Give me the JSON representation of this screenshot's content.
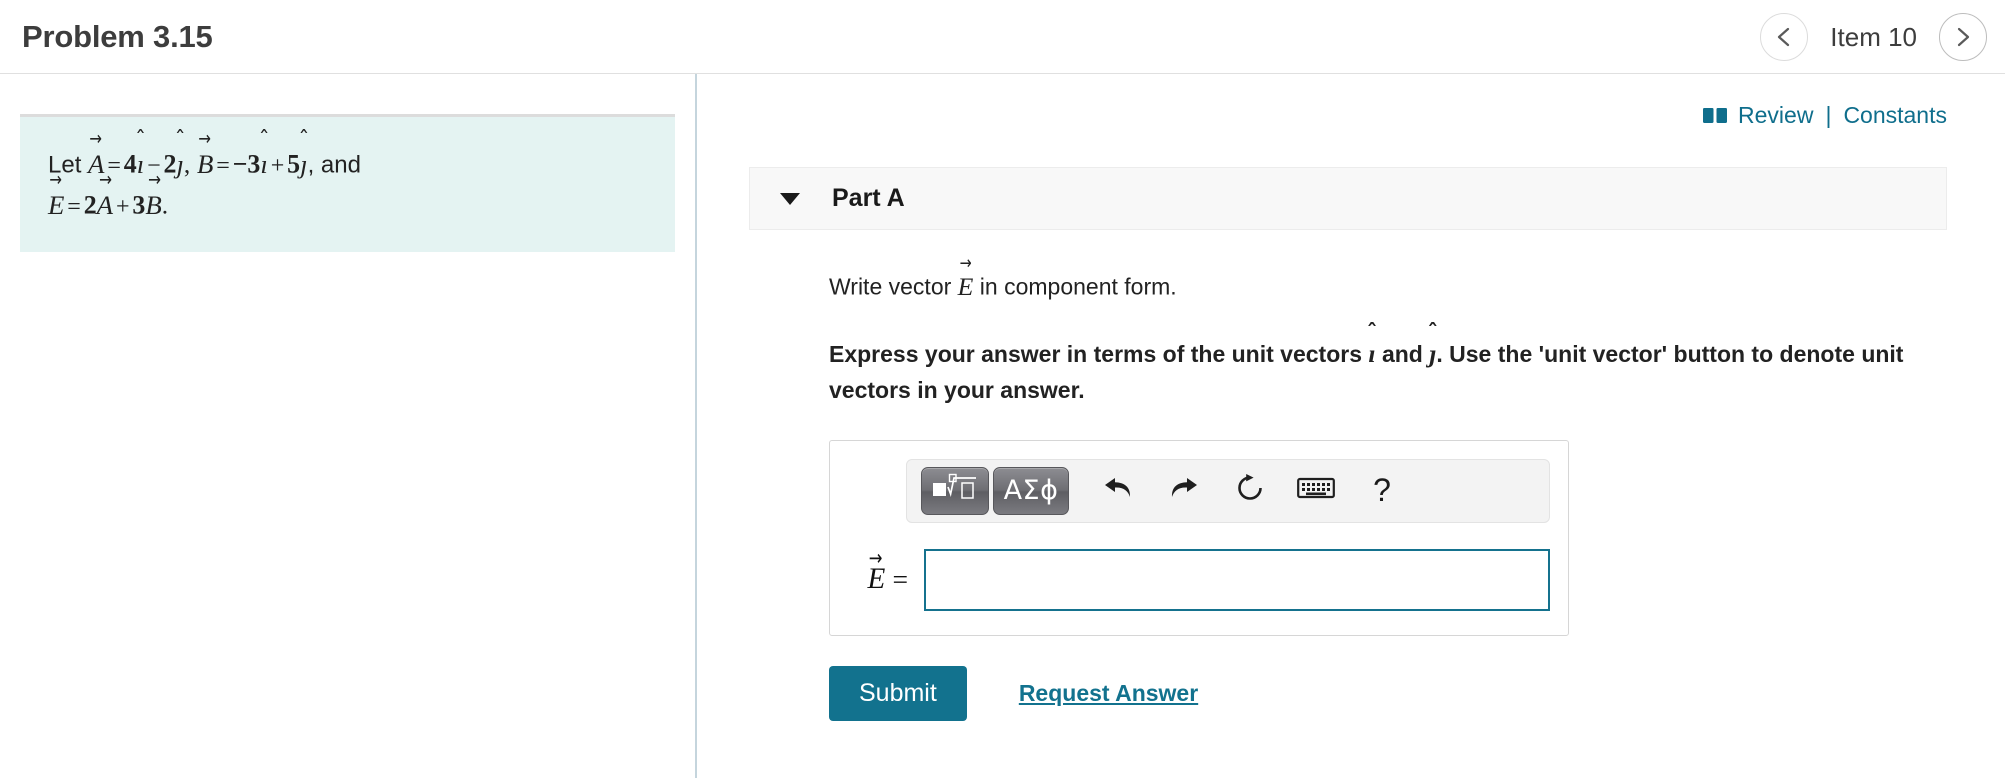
{
  "header": {
    "title": "Problem 3.15",
    "item_label": "Item 10",
    "prev_icon": "chevron-left-icon",
    "next_icon": "chevron-right-icon"
  },
  "problem": {
    "line1": {
      "lead": "Let",
      "vec_a": "A",
      "eq": "=",
      "a_i_coeff": "4",
      "i_hat": "ı",
      "minus": "−",
      "a_j_coeff": "2",
      "j_hat": "ȷ",
      "comma": ",",
      "vec_b": "B",
      "eq2": "=",
      "b_i_coeff": "−3",
      "plus": "+",
      "b_j_coeff": "5",
      "trailing": ", and"
    },
    "line2": {
      "vec_e": "E",
      "eq": "=",
      "coeff_a": "2",
      "vec_a": "A",
      "plus": "+",
      "coeff_b": "3",
      "vec_b": "B",
      "period": "."
    }
  },
  "review": {
    "book_icon": "book-icon",
    "review_label": "Review",
    "separator": "|",
    "constants_label": "Constants"
  },
  "part": {
    "caret_icon": "caret-down-icon",
    "title": "Part A",
    "question_prefix": "Write vector",
    "question_vector": "E",
    "question_suffix": "in component form.",
    "instruction_part1": "Express your answer in terms of the unit vectors",
    "instruction_i": "ı",
    "instruction_and": "and",
    "instruction_j": "ȷ",
    "instruction_part2": ". Use the 'unit vector' button to denote unit vectors in your answer."
  },
  "editor": {
    "toolbar": [
      {
        "name": "math-template-button",
        "type": "glyph",
        "icon": "sqrt-template-icon",
        "label": ""
      },
      {
        "name": "greek-symbols-button",
        "type": "text",
        "icon": "greek-letters-icon",
        "label": "ΑΣϕ"
      },
      {
        "name": "undo-button",
        "type": "icon",
        "icon": "undo-arrow-icon",
        "label": ""
      },
      {
        "name": "redo-button",
        "type": "icon",
        "icon": "redo-arrow-icon",
        "label": ""
      },
      {
        "name": "reset-button",
        "type": "icon",
        "icon": "reset-circular-arrow-icon",
        "label": ""
      },
      {
        "name": "keyboard-button",
        "type": "icon",
        "icon": "keyboard-icon",
        "label": ""
      },
      {
        "name": "help-button",
        "type": "icon",
        "icon": "question-mark-icon",
        "label": "?"
      }
    ],
    "answer_label_vector": "E",
    "answer_label_eq": "=",
    "answer_value": "",
    "answer_placeholder": ""
  },
  "actions": {
    "submit_label": "Submit",
    "request_answer_label": "Request Answer"
  },
  "colors": {
    "teal": "#12728e",
    "problem_bg": "#e4f3f2",
    "divider": "#c5d5dd",
    "panel_bg": "#f8f8f8"
  }
}
